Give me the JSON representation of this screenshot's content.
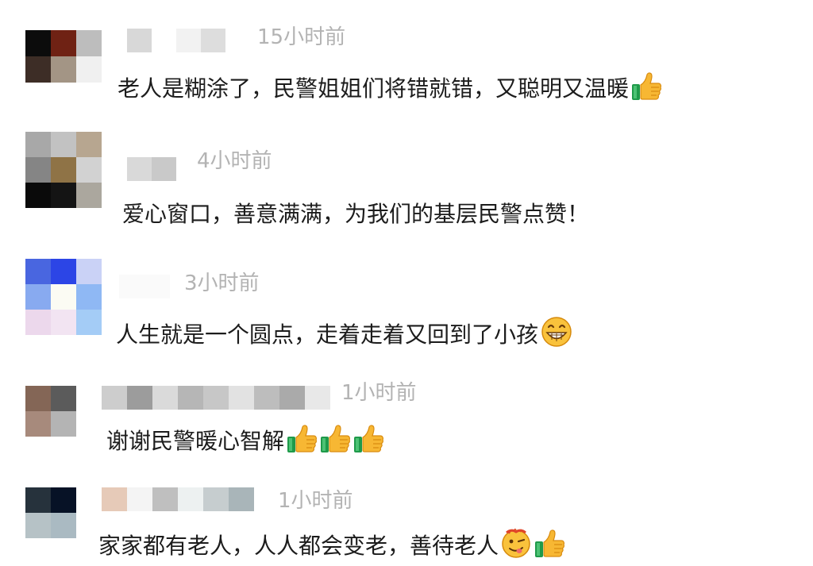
{
  "comments": [
    {
      "time": "15小时前",
      "text": "老人是糊涂了，民警姐姐们将错就错，又聪明又温暖",
      "emojis": [
        "thumbs-up"
      ],
      "avatar_colors": [
        "#0c0c0c",
        "#6f2214",
        "#bdbdbd",
        "#3d2d26",
        "#a39585",
        "#f0f0f0"
      ],
      "username_colors": [
        "#d8d8d8",
        "#ffffff",
        "#f2f2f2",
        "#dddddd"
      ]
    },
    {
      "time": "4小时前",
      "text": "爱心窗口，善意满满，为我们的基层民警点赞！",
      "emojis": [],
      "avatar_colors": [
        "#a8a8a8",
        "#c2c2c2",
        "#b7a690",
        "#858585",
        "#8f7346",
        "#d2d2d2",
        "#0a0a0a",
        "#141414",
        "#aba79e"
      ],
      "username_colors": [
        "#d9d9d9",
        "#c9c9c9"
      ]
    },
    {
      "time": "3小时前",
      "text": "人生就是一个圆点，走着走着又回到了小孩",
      "emojis": [
        "grin"
      ],
      "avatar_colors": [
        "#4966e0",
        "#2c45e6",
        "#cad2f6",
        "#88aaf0",
        "#fbfbf3",
        "#8fb8f4",
        "#ecd8ec",
        "#f2e4f2",
        "#a4ccf6"
      ],
      "username_colors": [
        "#fafafa"
      ]
    },
    {
      "time": "1小时前",
      "text": "谢谢民警暖心智解",
      "emojis": [
        "thumbs-up",
        "thumbs-up",
        "thumbs-up"
      ],
      "avatar_colors": [
        "#846656",
        "#5b5b5b",
        "#a78a7c",
        "#b4b4b4"
      ],
      "username_colors": [
        "#cdcdcd",
        "#9c9c9c",
        "#dadada",
        "#b6b6b6",
        "#c7c7c7",
        "#e2e2e2",
        "#bdbdbd",
        "#aaaaaa",
        "#e8e8e8"
      ]
    },
    {
      "time": "1小时前",
      "text": "家家都有老人，人人都会变老，善待老人",
      "emojis": [
        "zany",
        "thumbs-up"
      ],
      "avatar_colors": [
        "#26323c",
        "#071226",
        "#b6c2c6",
        "#aabac2"
      ],
      "username_colors": [
        "#e6cab8",
        "#f4f4f4",
        "#bfbfbf",
        "#edf1f1",
        "#c6cdcf",
        "#a9b5b9"
      ]
    }
  ]
}
